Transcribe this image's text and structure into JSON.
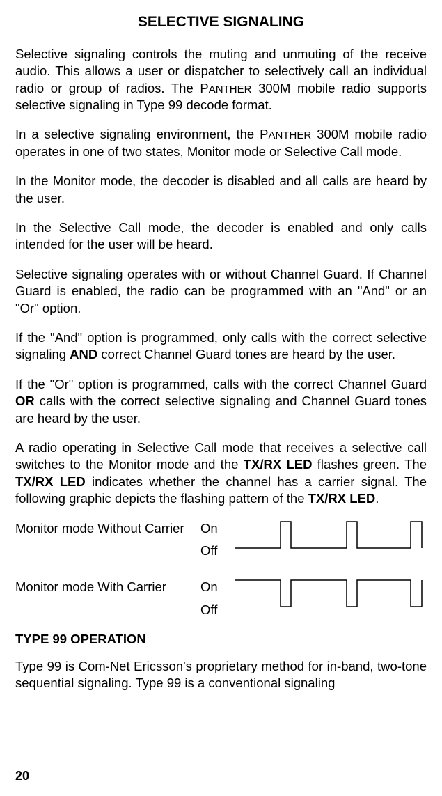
{
  "heading": "SELECTIVE SIGNALING",
  "p1a": "Selective signaling controls the muting and unmuting of the receive audio.  This allows a user or dispatcher to selectively call an individual radio or group of radios.  The ",
  "p1_brand1a": "P",
  "p1_brand1b": "ANTHER",
  "p1c": " 300M mobile radio supports selective signaling in Type 99 decode format.",
  "p2a": "In a selective signaling environment, the ",
  "p2_brand1a": "P",
  "p2_brand1b": "ANTHER",
  "p2c": " 300M mobile radio operates in one of two states, Monitor mode or Selective Call mode.",
  "p3": "In the Monitor mode, the decoder is disabled and all calls are heard by the user.",
  "p4": "In the Selective Call mode, the decoder is enabled and only calls intended for the user will be heard.",
  "p5": "Selective signaling operates with or without Channel Guard. If Channel Guard is enabled, the radio can be programmed with an \"And\" or an \"Or\" option.",
  "p6a": "If the \"And\" option is programmed, only calls with the correct selective signaling ",
  "p6_bold": "AND",
  "p6c": " correct Channel Guard tones are heard by the user.",
  "p7a": "If the \"Or\" option is programmed, calls with the correct Channel Guard ",
  "p7_bold": "OR",
  "p7c": " calls with the correct selective signaling and Channel Guard tones are heard by the user.",
  "p8a": "A radio operating in Selective Call mode that receives a selective call switches to the Monitor mode and the ",
  "p8_bold1": "TX/RX LED",
  "p8b": " flashes green. The ",
  "p8_bold2": "TX/RX LED",
  "p8c": " indicates whether the channel has a carrier signal. The following graphic depicts the flashing pattern of the ",
  "p8_bold3": "TX/RX LED",
  "p8d": ".",
  "diag1_label": "Monitor mode Without Carrier",
  "diag2_label": "Monitor mode With Carrier",
  "state_on": "On",
  "state_off": "Off",
  "heading2": "TYPE 99 OPERATION",
  "p9": "Type 99 is Com-Net Ericsson's proprietary method for in-band, two-tone sequential signaling.  Type 99 is a conventional signaling",
  "page_number": "20"
}
